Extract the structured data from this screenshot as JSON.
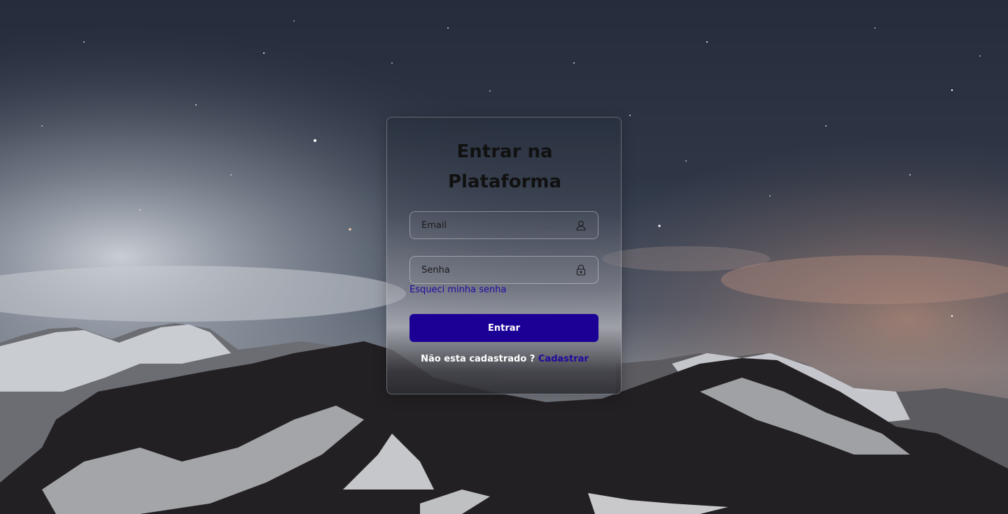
{
  "login": {
    "title": "Entrar na Plataforma",
    "email_placeholder": "Email",
    "email_value": "",
    "password_placeholder": "Senha",
    "password_value": "",
    "forgot_password": "Esqueci minha senha",
    "submit_label": "Entrar",
    "register_prompt": "Não esta cadastrado ?",
    "register_link": "Cadastrar"
  },
  "icons": {
    "email": "user-icon",
    "password": "lock-icon"
  },
  "colors": {
    "primary_button": "#1c0096",
    "link": "#1f0aa0",
    "title_text": "#111111"
  }
}
